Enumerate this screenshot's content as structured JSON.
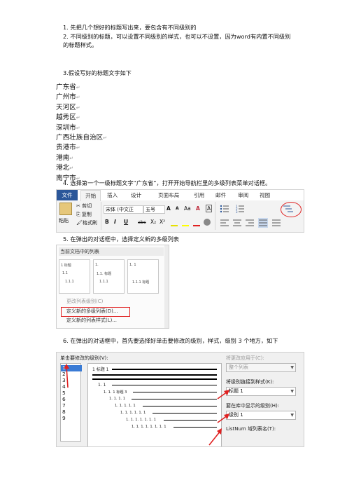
{
  "steps": {
    "s1": "1. 先把几个想好的标题写出来，要包含有不同级别的",
    "s2a": "2. 不同级别的标题，可以设置不同级别的样式，也可以不设置，因为word有内置不同级别",
    "s2b": "的标题样式。",
    "s3": "3.假设写好的标题文字如下",
    "s4": "4. 选择第一个一级标题文字“广东省”，打开开始导航栏里的多级列表菜单对话框。",
    "s5": "5. 在弹出的对话框中，选择定义新的多级列表",
    "s6": "6. 在弹出的对话框中，首先要选择好单击要修改的级别，样式，级别 3 个地方，如下"
  },
  "cities": [
    "广东省",
    "广州市",
    "天河区",
    "越秀区",
    "深圳市",
    "广西壮族自治区",
    "贵港市",
    "港南",
    "港北",
    "南宁市"
  ],
  "ribbon": {
    "tabs": [
      "文件",
      "开始",
      "插入",
      "设计",
      "页面布局",
      "引用",
      "邮件",
      "审阅",
      "视图"
    ],
    "paste": "粘贴",
    "cut": "剪切",
    "copy": "复制",
    "format_painter": "格式刷",
    "font_name": "宋体 (中文正",
    "font_size": "五号",
    "font_controls": [
      "A",
      "A",
      "Aa",
      "A",
      "A"
    ],
    "bold": "B",
    "italic": "I",
    "underline": "U",
    "strike": "abc",
    "sub": "X₂",
    "sup": "X²",
    "paragraph_marks": [
      "≡",
      "≡",
      "≡"
    ]
  },
  "gallery": {
    "title": "当前文档中的列表",
    "thumb_labels": [
      "1 标题",
      "1.1",
      "1.1.1",
      "1.",
      "1.1. 标题",
      "1.1.1",
      "1. 1",
      "1.1.1 标题"
    ],
    "items": [
      "更改列表级别(C)",
      "定义新的多级列表(D)...",
      "定义新的列表样式(L)..."
    ]
  },
  "dialog": {
    "level_label": "单击要修改的级别(V):",
    "levels": [
      "1",
      "2",
      "3",
      "4",
      "5",
      "6",
      "7",
      "8",
      "9"
    ],
    "preview_lines": [
      "1 标题 1",
      "1. 1",
      "1. 1. 1 标题 3",
      "1. 1. 1. 1",
      "1. 1. 1. 1. 1",
      "1. 1. 1. 1. 1. 1",
      "1. 1. 1. 1. 1. 1. 1",
      "1. 1. 1. 1. 1. 1. 1. 1"
    ],
    "apply_label": "将更改应用于(C):",
    "apply_value": "整个列表",
    "link_label": "将级别链接到样式(K):",
    "link_value": "标题 1",
    "gallery_level_label": "要在库中显示的级别(H):",
    "gallery_level_value": "级别 1",
    "listnum_label": "ListNum 域列表名(T):"
  },
  "colors": {
    "accent": "#2b579a",
    "highlight": "#e02020",
    "selection": "#3a7bd5"
  }
}
